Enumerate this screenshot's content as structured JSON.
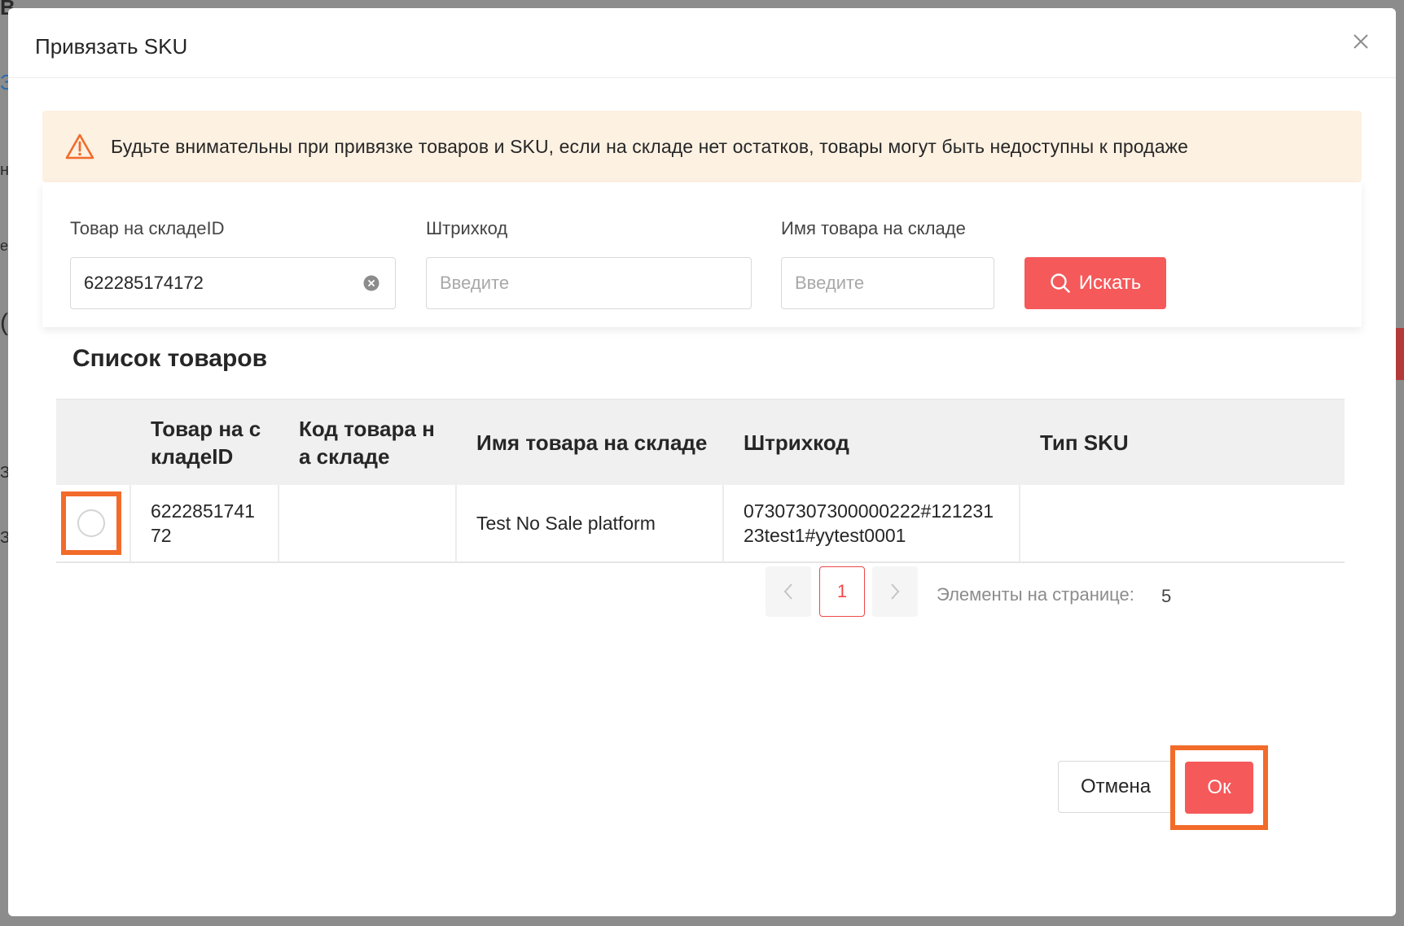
{
  "background": {
    "fragments": [
      "В",
      "З",
      "н",
      "е",
      "(",
      "З",
      "З",
      "П"
    ]
  },
  "modal": {
    "title": "Привязать SKU",
    "close_icon": "close-icon"
  },
  "alert": {
    "icon": "warning-icon",
    "text": "Будьте внимательны при привязке товаров и SKU, если на складе нет остатков, товары могут быть недоступны к продаже"
  },
  "search": {
    "warehouse_id_label": "Товар на складеID",
    "warehouse_id_value": "622285174172",
    "barcode_label": "Штрихкод",
    "barcode_placeholder": "Введите",
    "name_label": "Имя товара на складе",
    "name_placeholder": "Введите",
    "search_button": "Искать"
  },
  "list": {
    "title": "Список товаров",
    "columns": {
      "warehouse_id": "Товар на с\nкладеID",
      "warehouse_code": "Код товара н\nа складе",
      "name": "Имя товара на складе",
      "barcode": "Штрихкод",
      "sku_type": "Тип SKU"
    },
    "rows": [
      {
        "warehouse_id": "6222851741\n72",
        "warehouse_code": "",
        "name": "Test No Sale platform",
        "barcode": "07307307300000222#121231\n23test1#yytest0001",
        "sku_type": ""
      }
    ]
  },
  "pagination": {
    "current_page": "1",
    "page_size_label": "Элементы на странице:",
    "page_size_value": "5"
  },
  "footer": {
    "cancel_label": "Отмена",
    "ok_label": "Ок"
  },
  "colors": {
    "primary": "#f5595a",
    "highlight": "#f26b2a",
    "alert_bg": "#fdf1e2"
  }
}
